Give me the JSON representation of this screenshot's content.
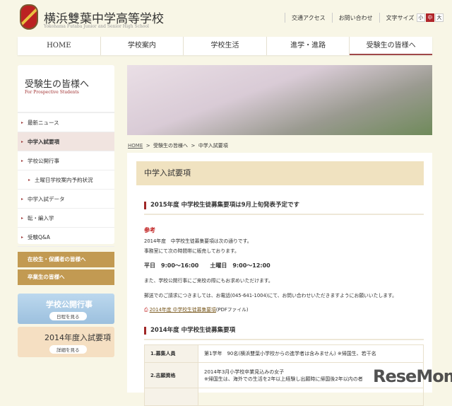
{
  "header": {
    "title": "横浜雙葉中学高等学校",
    "subtitle": "Yokohama Futaba Junior and Senior High School",
    "links": [
      "交通アクセス",
      "お問い合わせ"
    ],
    "font_size_label": "文字サイズ",
    "font_sizes": [
      "小",
      "中",
      "大"
    ]
  },
  "nav": [
    "HOME",
    "学校案内",
    "学校生活",
    "進学・進路",
    "受験生の皆様へ"
  ],
  "sidebar": {
    "title": "受験生の皆様へ",
    "subtitle": "For Prospective Students",
    "items": [
      "最新ニュース",
      "中学入試要項",
      "学校公開行事",
      "土曜日学校案内予約状況",
      "中学入試データ",
      "転・編入学",
      "受験Q&A"
    ],
    "gold_links": [
      "在校生・保護者の皆様へ",
      "卒業生の皆様へ"
    ],
    "banners": [
      {
        "title": "学校公開行事",
        "button": "日程を見る"
      },
      {
        "title": "2014年度入試要項",
        "button": "詳細を見る"
      }
    ]
  },
  "breadcrumb": [
    "HOME",
    ">",
    "受験生の皆様へ",
    ">",
    "中学入試要項"
  ],
  "main": {
    "title": "中学入試要項",
    "section1": "2015年度 中学校生徒募集要項は9月上旬発表予定です",
    "ref_label": "参考",
    "p1": "2014年度　中学校生徒募集要項は次の通りです。",
    "p2": "事務室にて次の時間帯に販売しております。",
    "hours": "平日　9:00～16:00　　土曜日　9:00～12:00",
    "p3": "また、学校公開行事にご来校の際にもお求めいただけます。",
    "p4": "郵送でのご請求につきましては、お電話(045-641-1004)にて、お問い合わせいただきますようにお願いいたします。",
    "pdf_link": "2014年度 中学校生徒募集要項",
    "pdf_suffix": "(PDFファイル)",
    "section2": "2014年度 中学校生徒募集要項",
    "table": [
      {
        "key": "1.募集人員",
        "value": "第1学年　90名(横浜雙葉小学校からの進学者は含みません) ※帰国生、若干名"
      },
      {
        "key": "2.志願資格",
        "value": "2014年3月小学校卒業見込みの女子",
        "value2": "※帰国生は、海外での生活を2年以上経験し出願時に帰国後2年以内の者"
      }
    ]
  },
  "watermark": "ReseMom"
}
